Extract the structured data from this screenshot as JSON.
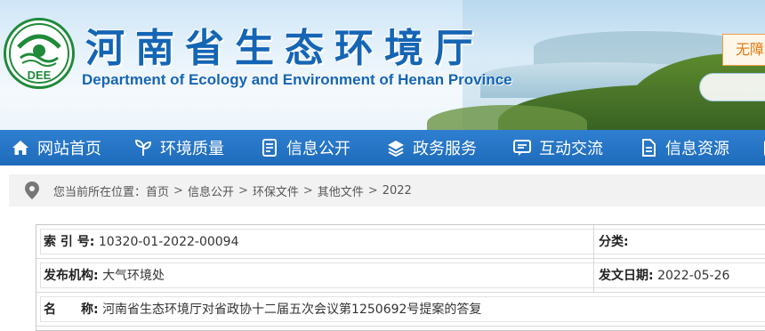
{
  "header": {
    "title": "河南省生态环境厅",
    "subtitle": "Department of Ecology and Environment of Henan Province",
    "logo_text": "DEE",
    "accessibility_label": "无障",
    "brand_color": "#1565b5"
  },
  "nav": {
    "items": [
      {
        "label": "网站首页",
        "icon": "home-icon"
      },
      {
        "label": "环境质量",
        "icon": "leaf-icon"
      },
      {
        "label": "信息公开",
        "icon": "document-icon"
      },
      {
        "label": "政务服务",
        "icon": "layers-icon"
      },
      {
        "label": "互动交流",
        "icon": "chat-icon"
      },
      {
        "label": "信息资源",
        "icon": "file-icon"
      }
    ],
    "color": "#2f7fd0"
  },
  "breadcrumb": {
    "prefix": "您当前所在位置：",
    "items": [
      "首页",
      "信息公开",
      "环保文件",
      "其他文件",
      "2022"
    ],
    "separator": ">"
  },
  "info": {
    "index_label": "索 引 号:",
    "index_value": "10320-01-2022-00094",
    "category_label": "分类:",
    "category_value": "",
    "publisher_label": "发布机构:",
    "publisher_value": "大气环境处",
    "date_label": "发文日期:",
    "date_value": "2022-05-26",
    "name_label": "名　　称:",
    "name_value": "河南省生态环境厅对省政协十二届五次会议第1250692号提案的答复"
  }
}
